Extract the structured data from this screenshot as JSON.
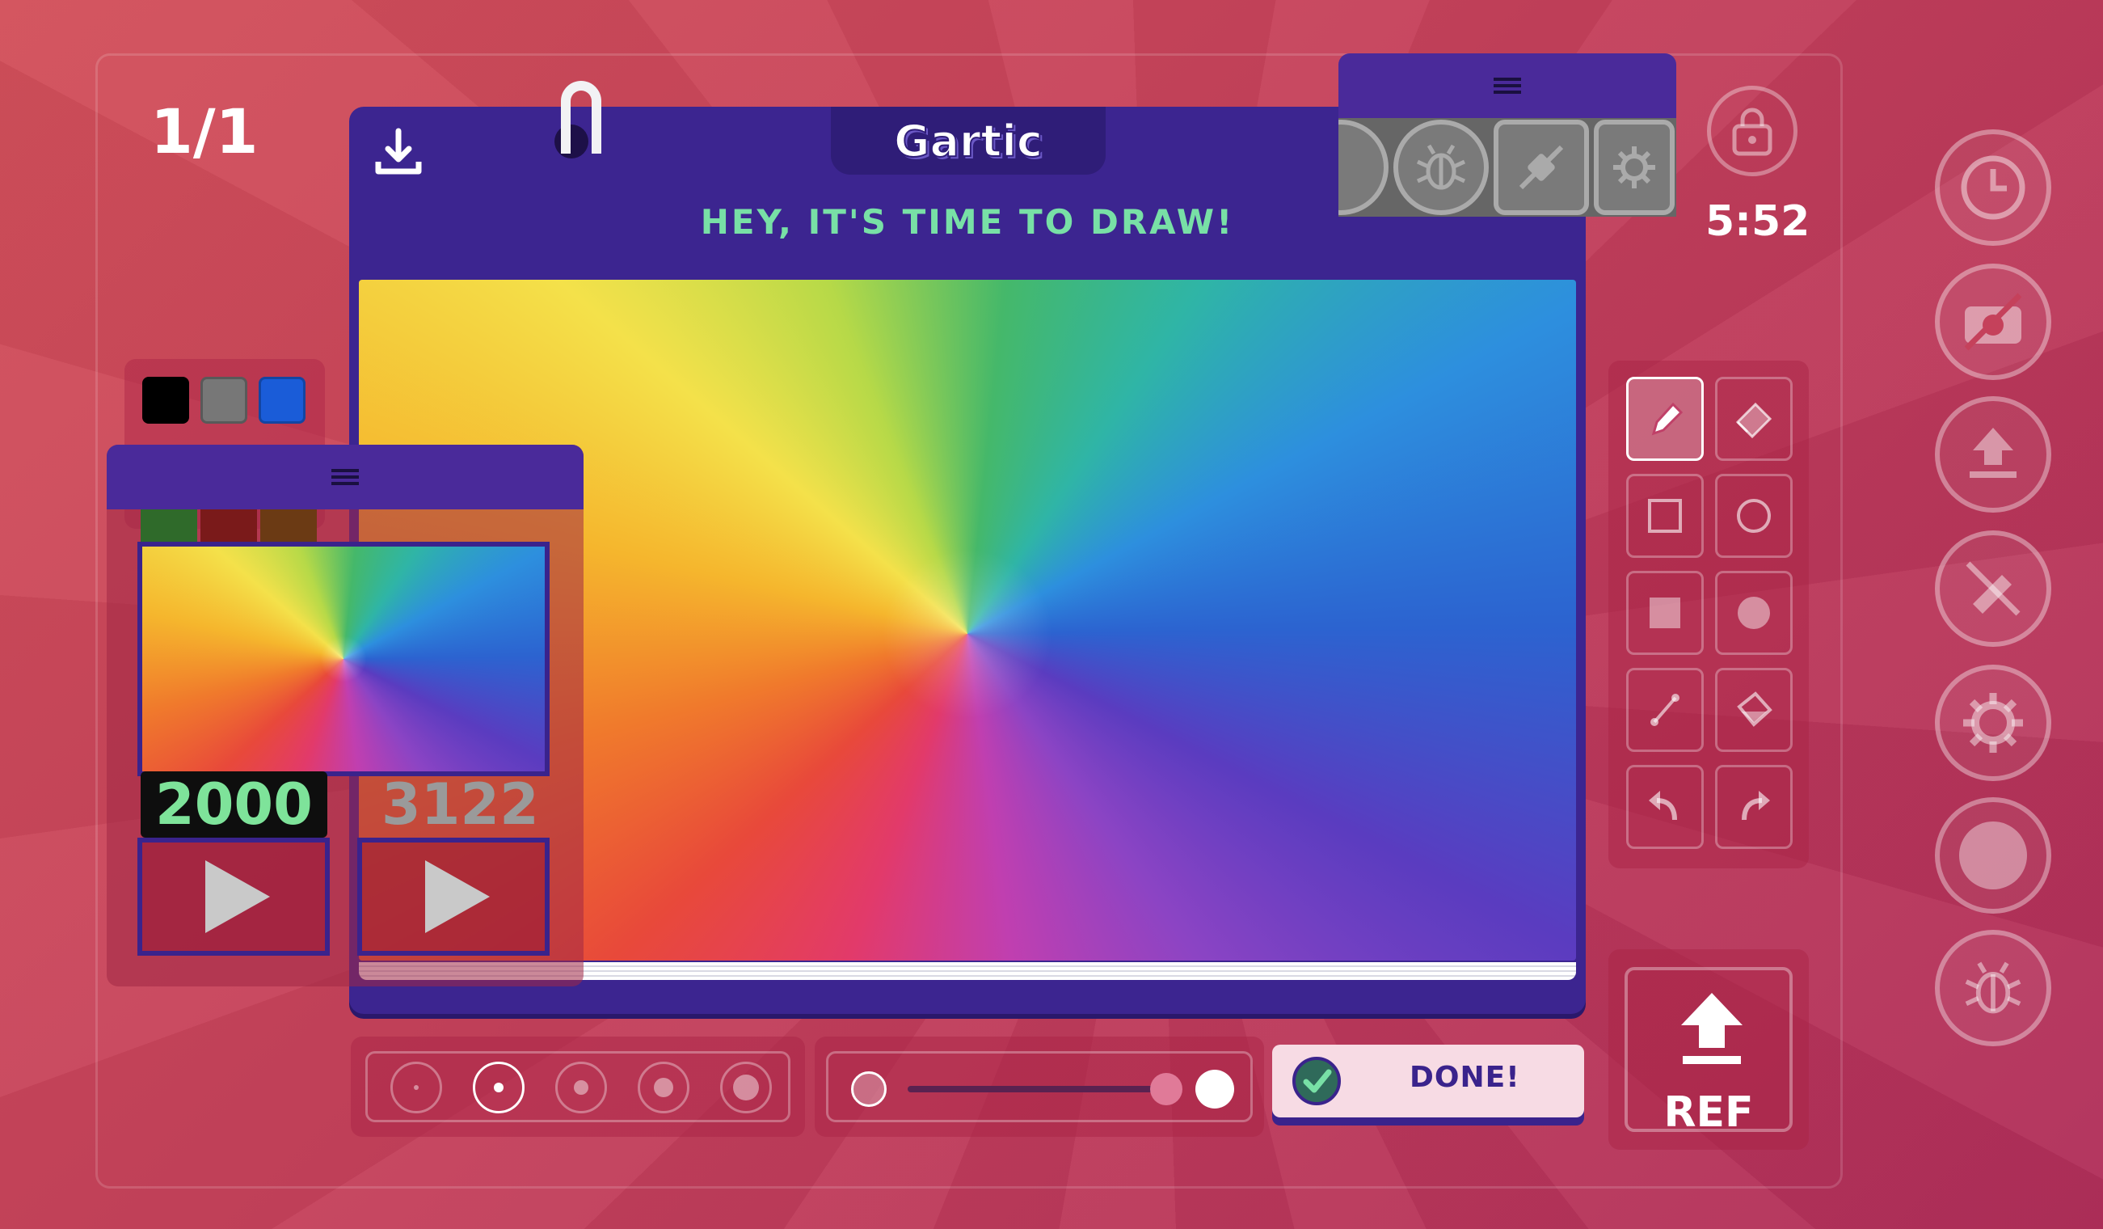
{
  "header": {
    "round_counter": "1/1",
    "timer": "5:52"
  },
  "book": {
    "logo_text": "Gartic",
    "prompt": "HEY, IT'S TIME TO DRAW!"
  },
  "palette": {
    "colors": [
      "#000000",
      "#777777",
      "#1a5cd8"
    ]
  },
  "mini_panel": {
    "value_a": "2000",
    "value_b": "3122"
  },
  "done_button": {
    "label": "DONE!"
  },
  "ref_button": {
    "label": "REF"
  },
  "tools": [
    "pencil",
    "eraser",
    "rectangle",
    "ellipse",
    "filled-rectangle",
    "filled-ellipse",
    "line",
    "fill-bucket",
    "undo",
    "redo"
  ],
  "right_column": [
    "clock",
    "camera-off",
    "upload",
    "no-pen",
    "settings",
    "circle",
    "bug"
  ],
  "accent_colors": {
    "purple": "#3c2590",
    "green": "#78e0a6",
    "background": "#c5415b"
  }
}
